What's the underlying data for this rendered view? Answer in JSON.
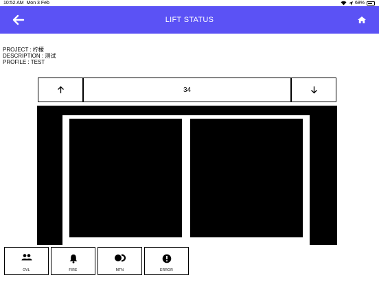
{
  "status_bar": {
    "time": "10:52 AM",
    "date": "Mon 3 Feb",
    "battery": "68%"
  },
  "header": {
    "title": "LIFT STATUS"
  },
  "info": {
    "project": "PROJECT : 柠檬",
    "description": "DESCRIPTION : 测试",
    "profile": "PROFILE : TEST"
  },
  "floor": {
    "current": "34"
  },
  "status_buttons": [
    {
      "label": "OVL",
      "icon": "people-icon"
    },
    {
      "label": "FIRE",
      "icon": "bell-icon"
    },
    {
      "label": "MTN",
      "icon": "toggle-icon"
    },
    {
      "label": "ERROR",
      "icon": "alert-icon"
    }
  ],
  "colors": {
    "appbar": "#5b52f5",
    "shaft": "#000000",
    "background": "#ffffff"
  }
}
